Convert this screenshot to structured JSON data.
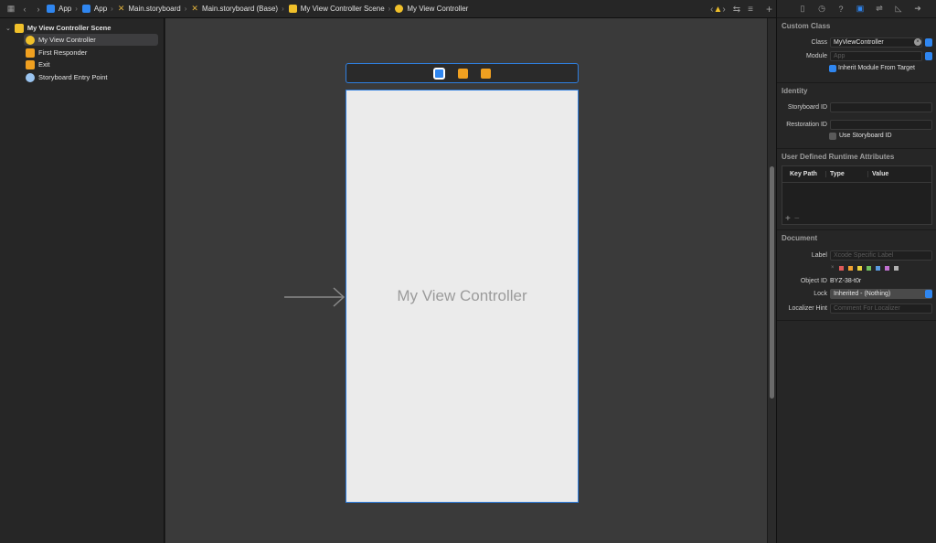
{
  "jumpbar": {
    "crumbs": [
      {
        "label": "App",
        "color": "#2f86f0"
      },
      {
        "label": "App",
        "color": "#2f86f0"
      },
      {
        "label": "Main.storyboard",
        "color": "#e0b13c"
      },
      {
        "label": "Main.storyboard (Base)",
        "color": "#e0b13c"
      },
      {
        "label": "My View Controller Scene",
        "color": "#f0c02a"
      },
      {
        "label": "My View Controller",
        "color": "#f0c02a"
      }
    ]
  },
  "outline": {
    "scene": "My View Controller Scene",
    "items": [
      {
        "label": "My View Controller",
        "icon": "view-controller-icon",
        "color": "#f0c02a"
      },
      {
        "label": "First Responder",
        "icon": "first-responder-icon",
        "color": "#f0a020"
      },
      {
        "label": "Exit",
        "icon": "exit-icon",
        "color": "#f0a020"
      },
      {
        "label": "Storyboard Entry Point",
        "icon": "entry-point-icon",
        "color": "#9ac4f0"
      }
    ]
  },
  "canvas": {
    "vc_title": "My View Controller"
  },
  "inspector": {
    "custom_class": {
      "title": "Custom Class",
      "class_label": "Class",
      "class_value": "MyViewController",
      "module_label": "Module",
      "module_placeholder": "App",
      "inherit_label": "Inherit Module From Target"
    },
    "identity": {
      "title": "Identity",
      "storyboard_id_label": "Storyboard ID",
      "restoration_id_label": "Restoration ID",
      "use_storyboard_id_label": "Use Storyboard ID"
    },
    "runtime_attrs": {
      "title": "User Defined Runtime Attributes",
      "columns": [
        "Key Path",
        "Type",
        "Value"
      ]
    },
    "document": {
      "title": "Document",
      "label_label": "Label",
      "label_placeholder": "Xcode Specific Label",
      "object_id_label": "Object ID",
      "object_id_value": "BYZ-38-t0r",
      "lock_label": "Lock",
      "lock_value": "Inherited - (Nothing)",
      "localizer_label": "Localizer Hint",
      "localizer_placeholder": "Comment For Localizer",
      "swatches": [
        "#e05a5a",
        "#f0a030",
        "#e8d040",
        "#70c060",
        "#5a9ae0",
        "#c070d0",
        "#b0b0b0"
      ]
    }
  }
}
